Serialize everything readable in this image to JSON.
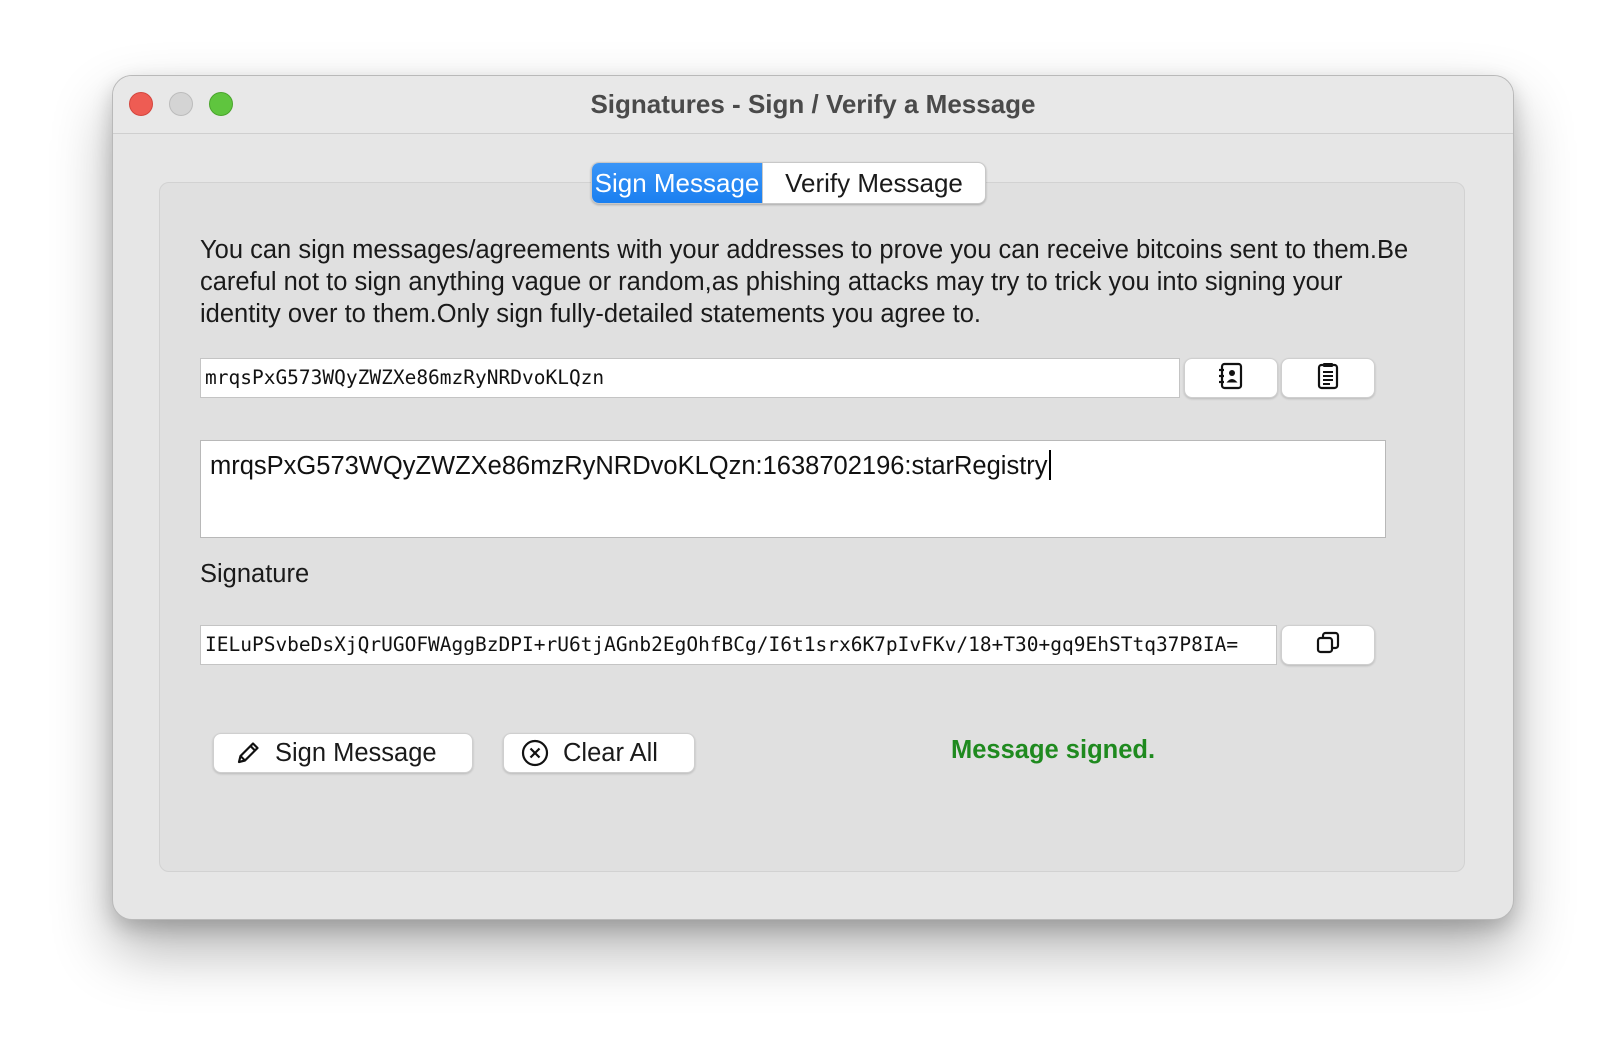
{
  "window": {
    "title": "Signatures - Sign / Verify a Message"
  },
  "tabs": [
    {
      "label": "Sign Message",
      "active": true
    },
    {
      "label": "Verify Message",
      "active": false
    }
  ],
  "description": "You can sign messages/agreements with your addresses to prove you can receive bitcoins sent to them.Be careful not to sign anything vague or random,as phishing attacks may try to trick you into signing your identity over to them.Only sign fully-detailed statements you agree to.",
  "address_field": {
    "value": "mrqsPxG573WQyZWZXe86mzRyNRDvoKLQzn"
  },
  "message_field": {
    "value": "mrqsPxG573WQyZWZXe86mzRyNRDvoKLQzn:1638702196:starRegistry"
  },
  "signature": {
    "label": "Signature",
    "value": "IELuPSvbeDsXjQrUGOFWAggBzDPI+rU6tjAGnb2EgOhfBCg/I6t1srx6K7pIvFKv/18+T30+gq9EhSTtq37P8IA="
  },
  "buttons": {
    "sign_label": "Sign Message",
    "clear_label": "Clear All"
  },
  "status": {
    "text": "Message signed.",
    "color": "#1f8a1f"
  },
  "colors": {
    "accent": "#1a7ff0",
    "close": "#ee5c53",
    "zoom": "#5fc53e"
  },
  "icons": {
    "address_book": "address-book-icon",
    "paste": "clipboard-paste-icon",
    "copy": "copy-icon",
    "sign": "pencil-icon",
    "clear": "circle-x-icon"
  }
}
